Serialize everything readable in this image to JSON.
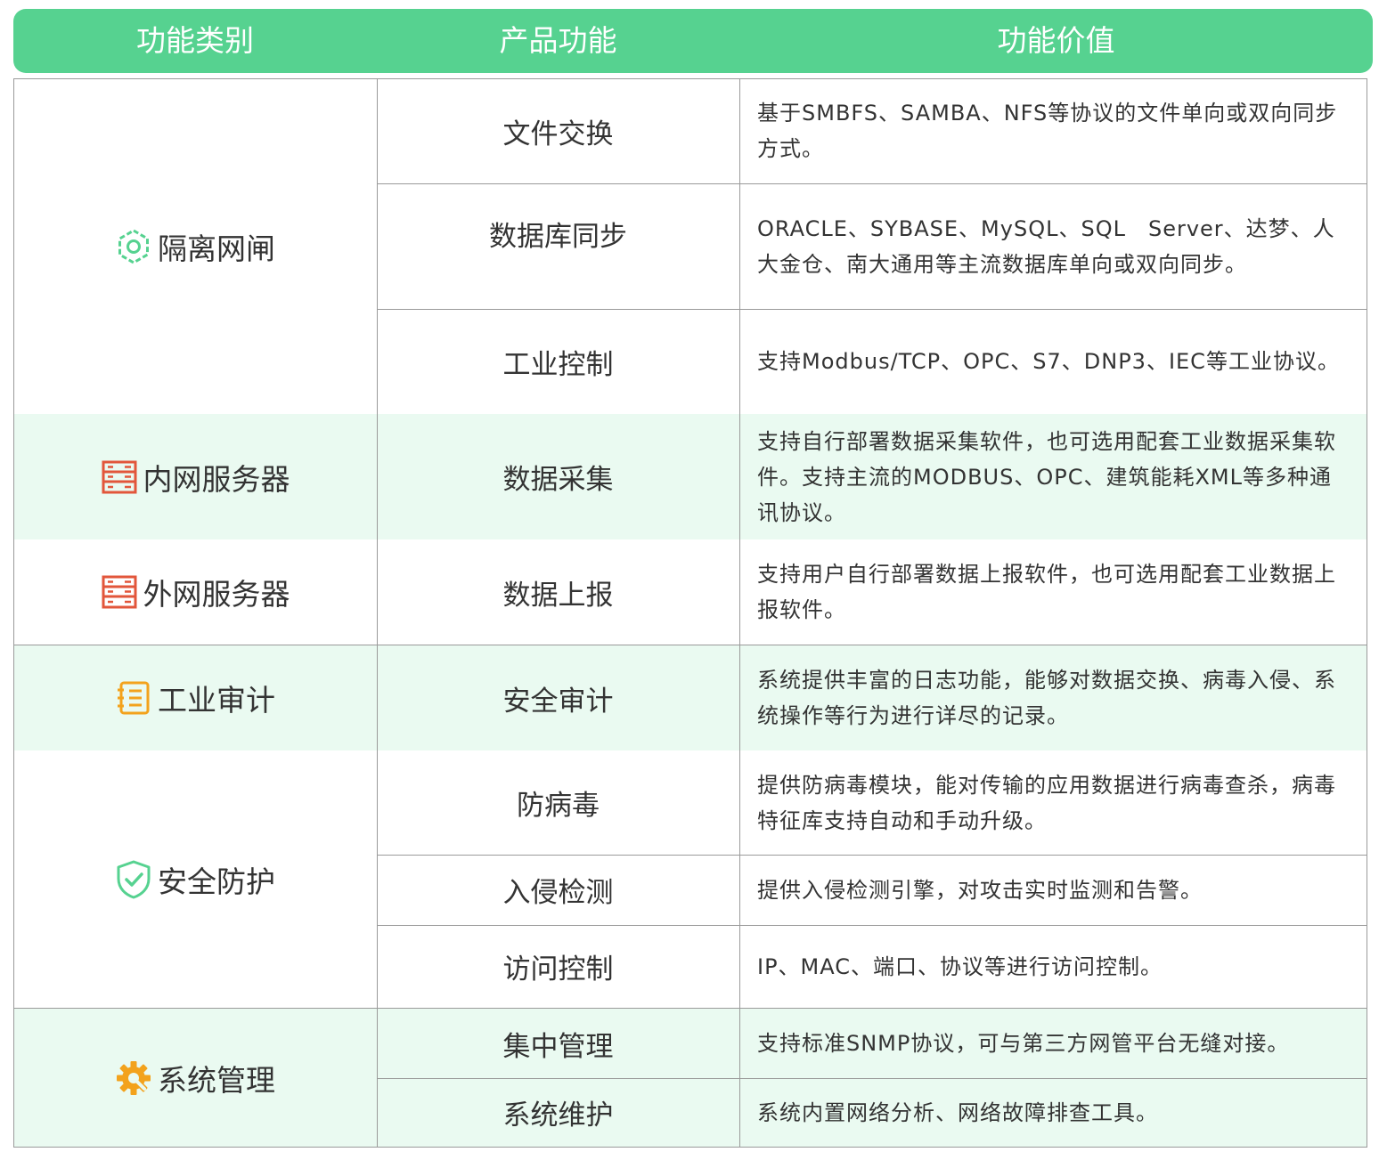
{
  "header": {
    "col1": "功能类别",
    "col2": "产品功能",
    "col3": "功能价值"
  },
  "colors": {
    "header_bg": "#56d290",
    "row_highlight": "#eafaf1",
    "icon_green": "#56d290",
    "icon_red": "#e2563b",
    "icon_orange": "#f3a21c"
  },
  "categories": [
    {
      "label": "隔离网闸",
      "icon": "hexagon-gear-icon"
    },
    {
      "label": "内网服务器",
      "icon": "server-rack-icon"
    },
    {
      "label": "外网服务器",
      "icon": "server-rack-icon"
    },
    {
      "label": "工业审计",
      "icon": "audit-list-icon"
    },
    {
      "label": "安全防护",
      "icon": "shield-check-icon"
    },
    {
      "label": "系统管理",
      "icon": "gear-wrench-icon"
    }
  ],
  "rows": [
    {
      "feature": "文件交换",
      "value": "基于SMBFS、SAMBA、NFS等协议的文件单向或双向同步方式。"
    },
    {
      "feature": "数据库同步",
      "value": "ORACLE、SYBASE、MySQL、SQL　Server、达梦、人大金仓、南大通用等主流数据库单向或双向同步。"
    },
    {
      "feature": "工业控制",
      "value": "支持Modbus/TCP、OPC、S7、DNP3、IEC等工业协议。"
    },
    {
      "feature": "数据采集",
      "value": "支持自行部署数据采集软件，也可选用配套工业数据采集软件。支持主流的MODBUS、OPC、建筑能耗XML等多种通讯协议。"
    },
    {
      "feature": "数据上报",
      "value": "支持用户自行部署数据上报软件，也可选用配套工业数据上报软件。"
    },
    {
      "feature": "安全审计",
      "value": "系统提供丰富的日志功能，能够对数据交换、病毒入侵、系统操作等行为进行详尽的记录。"
    },
    {
      "feature": "防病毒",
      "value": "提供防病毒模块，能对传输的应用数据进行病毒查杀，病毒特征库支持自动和手动升级。"
    },
    {
      "feature": "入侵检测",
      "value": "提供入侵检测引擎，对攻击实时监测和告警。"
    },
    {
      "feature": "访问控制",
      "value": "IP、MAC、端口、协议等进行访问控制。"
    },
    {
      "feature": "集中管理",
      "value": "支持标准SNMP协议，可与第三方网管平台无缝对接。"
    },
    {
      "feature": "系统维护",
      "value": "系统内置网络分析、网络故障排查工具。"
    }
  ]
}
